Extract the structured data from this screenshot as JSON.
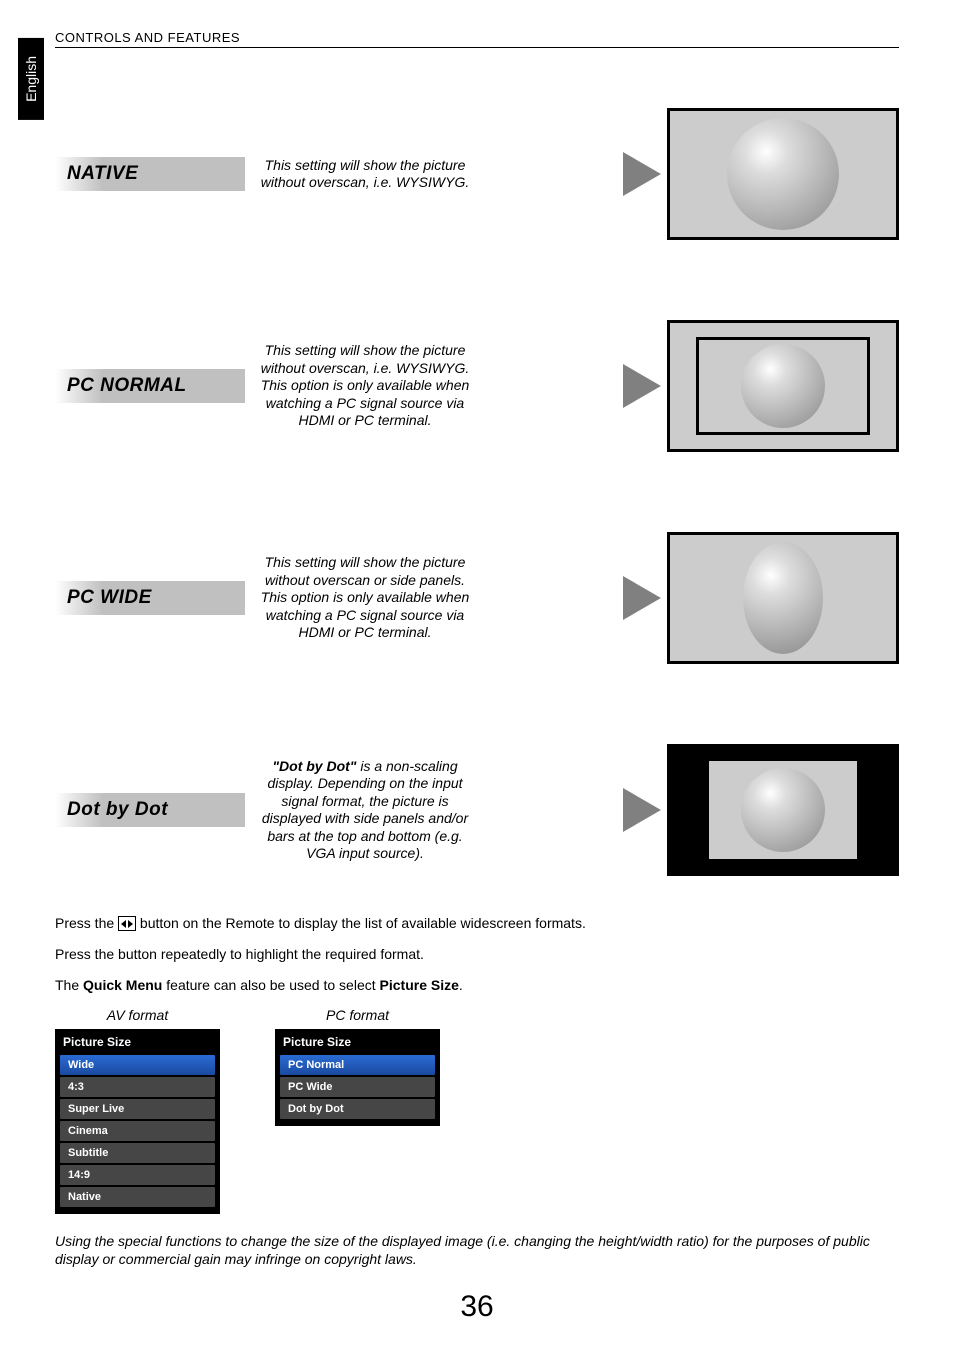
{
  "lang_tab": "English",
  "section_header": "CONTROLS AND FEATURES",
  "rows": {
    "native": {
      "label": "NATIVE",
      "desc": "This setting will show the picture without overscan, i.e. WYSIWYG."
    },
    "pcnormal": {
      "label": "PC NORMAL",
      "desc": "This setting will show the picture without overscan, i.e. WYSIWYG. This option is only available when watching a PC signal source via HDMI or PC terminal."
    },
    "pcwide": {
      "label": "PC WIDE",
      "desc": "This setting will show the picture without overscan or side panels. This option is only available when watching a PC signal source via HDMI or PC terminal."
    },
    "dotbydot": {
      "label": "Dot by Dot",
      "desc_strong": "\"Dot by Dot\"",
      "desc_rest": " is a non-scaling display. Depending on the input signal format, the picture is displayed with side panels and/or bars at the top and bottom (e.g. VGA input source)."
    }
  },
  "body": {
    "p1_a": "Press the ",
    "p1_b": " button on the Remote to display the list of available widescreen formats.",
    "p2": "Press the button repeatedly to highlight the required format.",
    "p3_a": "The ",
    "p3_b": "Quick Menu",
    "p3_c": " feature can also be used to select ",
    "p3_d": "Picture Size",
    "p3_e": "."
  },
  "menus": {
    "av": {
      "caption": "AV format",
      "title": "Picture Size",
      "items": [
        "Wide",
        "4:3",
        "Super Live",
        "Cinema",
        "Subtitle",
        "14:9",
        "Native"
      ],
      "selected_index": 0
    },
    "pc": {
      "caption": "PC format",
      "title": "Picture Size",
      "items": [
        "PC Normal",
        "PC Wide",
        "Dot by Dot"
      ],
      "selected_index": 0
    }
  },
  "footnote": "Using the special functions to change the size of the displayed image (i.e. changing the height/width ratio) for the purposes of public display or commercial gain may infringe on copyright laws.",
  "page_number": "36"
}
